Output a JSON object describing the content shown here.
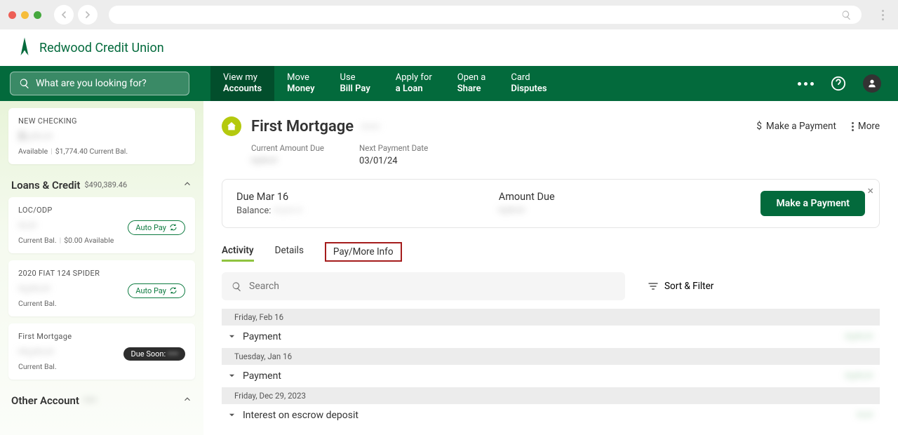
{
  "brand": {
    "name": "Redwood Credit Union"
  },
  "browser": {
    "search_icon": "search"
  },
  "nav": {
    "search_placeholder": "What are you looking for?",
    "items": [
      {
        "l1": "View my",
        "l2": "Accounts",
        "active": true
      },
      {
        "l1": "Move",
        "l2": "Money"
      },
      {
        "l1": "Use",
        "l2": "Bill Pay"
      },
      {
        "l1": "Apply for",
        "l2": "a Loan"
      },
      {
        "l1": "Open a",
        "l2": "Share"
      },
      {
        "l1": "Card",
        "l2": "Disputes"
      }
    ]
  },
  "sidebar": {
    "checking": {
      "name": "NEW CHECKING",
      "masked": "$•,•••.••",
      "meta_left": "Available",
      "meta_right": "$1,774.40 Current Bal."
    },
    "loans_title": "Loans & Credit",
    "loans_total": "$490,389.46",
    "autopay_label": "Auto Pay",
    "loans": [
      {
        "name": "LOC/ODP",
        "masked": "••.••",
        "meta_left": "Current Bal.",
        "meta_right": "$0.00 Available",
        "autopay": true
      },
      {
        "name": "2020 FIAT 124 SPIDER",
        "masked": "••,•••.••",
        "meta_left": "Current Bal.",
        "autopay": true
      },
      {
        "name": "First Mortgage",
        "masked": "•••,•••.••",
        "meta_left": "Current Bal.",
        "duesoon_label": "Due Soon:",
        "duesoon_val": "••••"
      }
    ],
    "other_title": "Other Account",
    "other_masked": "•••••"
  },
  "page": {
    "title": "First Mortgage",
    "title_sub": "•••••",
    "make_payment": "Make a Payment",
    "more": "More",
    "summary": [
      {
        "lbl": "Current Amount Due",
        "val": "••,•••.••"
      },
      {
        "lbl": "Next Payment Date",
        "val": "03/01/24"
      }
    ],
    "due_box": {
      "due_label": "Due Mar 16",
      "balance_label": "Balance:",
      "balance_val": "•••,•••.••",
      "amount_due_label": "Amount Due",
      "amount_due_val": "••,•••.••",
      "button": "Make a Payment"
    },
    "tabs": [
      "Activity",
      "Details",
      "Pay/More Info"
    ],
    "search_placeholder": "Search",
    "sort_filter": "Sort & Filter",
    "txns": [
      {
        "date": "Friday, Feb 16",
        "desc": "Payment",
        "amt": "••,•••.••"
      },
      {
        "date": "Tuesday, Jan 16",
        "desc": "Payment",
        "amt": "••,•••.••"
      },
      {
        "date": "Friday, Dec 29, 2023",
        "desc": "Interest on escrow deposit",
        "amt": "••.••"
      }
    ]
  }
}
